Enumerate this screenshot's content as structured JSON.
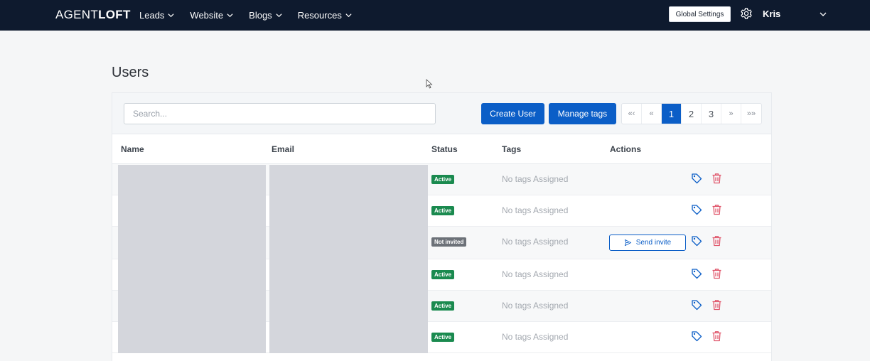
{
  "header": {
    "brand_light": "AGENT",
    "brand_bold": "LOFT",
    "nav": [
      {
        "label": "Leads"
      },
      {
        "label": "Website"
      },
      {
        "label": "Blogs"
      },
      {
        "label": "Resources"
      }
    ],
    "global_settings_label": "Global Settings",
    "user_name": "Kris"
  },
  "page": {
    "title": "Users"
  },
  "toolbar": {
    "search_placeholder": "Search...",
    "create_user_label": "Create User",
    "manage_tags_label": "Manage tags",
    "pagination": {
      "first": "«‹",
      "prev": "«",
      "pages": [
        "1",
        "2",
        "3"
      ],
      "current": "1",
      "next": "»",
      "last": "»»"
    }
  },
  "table": {
    "columns": [
      "Name",
      "Email",
      "Status",
      "Tags",
      "Actions"
    ],
    "rows": [
      {
        "status": "Active",
        "tags": "No tags Assigned",
        "action": ""
      },
      {
        "status": "Active",
        "tags": "No tags Assigned",
        "action": ""
      },
      {
        "status": "Not invited",
        "tags": "No tags Assigned",
        "action": "Send invite"
      },
      {
        "status": "Active",
        "tags": "No tags Assigned",
        "action": ""
      },
      {
        "status": "Active",
        "tags": "No tags Assigned",
        "action": ""
      },
      {
        "status": "Active",
        "tags": "No tags Assigned",
        "action": ""
      }
    ]
  },
  "colors": {
    "nav_bg": "#0e1a2e",
    "primary": "#0b5ec7",
    "status_active": "#1a8a4f",
    "status_not_invited": "#6c7178",
    "delete": "#e0566b"
  },
  "icons": {
    "nav_chevron": "chevron-down-icon",
    "settings": "gear-icon",
    "tag": "tag-icon",
    "delete": "trash-icon",
    "send": "send-icon"
  }
}
